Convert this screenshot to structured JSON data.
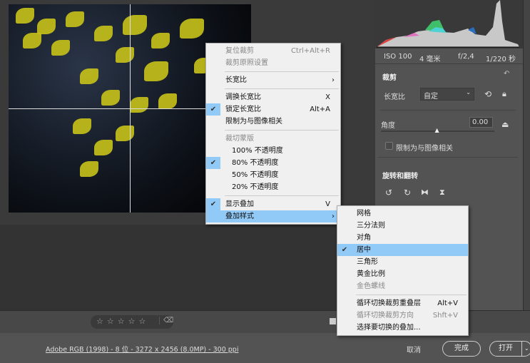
{
  "exif": {
    "iso": "ISO 100",
    "focal": "4 毫米",
    "aperture": "f/2,4",
    "shutter": "1/220 秒"
  },
  "crop_panel": {
    "title": "裁剪",
    "aspect_label": "长宽比",
    "aspect_value": "自定",
    "angle_label": "角度",
    "angle_value": "0.00",
    "angle_slider_fraction": 0.5,
    "constrain_label": "限制为与图像相关",
    "constrain_checked": false,
    "rotate_title": "旋转和翻转"
  },
  "context_menu": {
    "items": [
      {
        "label": "复位裁剪",
        "shortcut": "Ctrl+Alt+R",
        "disabled": true
      },
      {
        "label": "裁剪原照设置",
        "disabled": true
      },
      {
        "label": "长宽比",
        "submenu": true
      },
      {
        "label": "调换长宽比",
        "shortcut": "X"
      },
      {
        "label": "锁定长宽比",
        "shortcut": "Alt+A",
        "checked": true
      },
      {
        "label": "限制为与图像相关"
      },
      {
        "label": "裁切蒙版",
        "disabled": true
      },
      {
        "label": "100% 不透明度"
      },
      {
        "label": "80% 不透明度",
        "checked": true
      },
      {
        "label": "50% 不透明度"
      },
      {
        "label": "20% 不透明度"
      },
      {
        "label": "显示叠加",
        "shortcut": "V",
        "checked": true
      },
      {
        "label": "叠加样式",
        "submenu": true
      }
    ]
  },
  "overlay_submenu": {
    "items": [
      {
        "label": "网格"
      },
      {
        "label": "三分法则"
      },
      {
        "label": "对角"
      },
      {
        "label": "居中",
        "checked": true
      },
      {
        "label": "三角形"
      },
      {
        "label": "黄金比例"
      },
      {
        "label": "金色螺线",
        "disabled": true
      },
      {
        "label": "循环切换裁剪重叠层",
        "shortcut": "Alt+V"
      },
      {
        "label": "循环切换裁剪方向",
        "shortcut": "Shft+V",
        "disabled": true
      },
      {
        "label": "选择要切换的叠加..."
      }
    ]
  },
  "rating": {
    "stars": 0,
    "star_glyph": "☆",
    "trash_glyph": "🗑"
  },
  "footer": {
    "file_info": "Adobe RGB (1998) - 8 位 - 3272 x 2456 (8.0MP) - 300 ppi",
    "cancel": "取消",
    "done": "完成",
    "open": "打开"
  }
}
